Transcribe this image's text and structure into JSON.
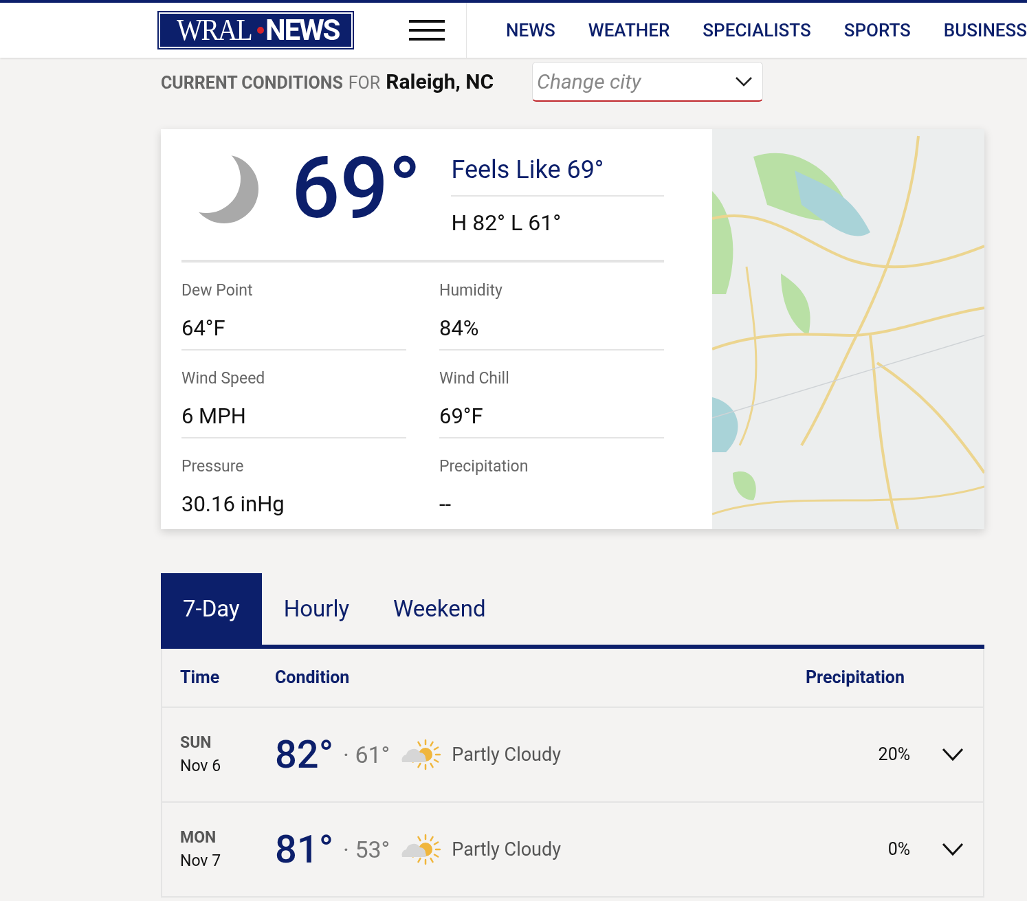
{
  "header": {
    "logo": {
      "left": "WRAL",
      "right": "NEWS"
    },
    "nav": [
      {
        "label": "NEWS"
      },
      {
        "label": "WEATHER"
      },
      {
        "label": "SPECIALISTS"
      },
      {
        "label": "SPORTS"
      },
      {
        "label": "BUSINESS"
      }
    ]
  },
  "conditions_bar": {
    "title_bold": "CURRENT CONDITIONS",
    "title_for": "FOR",
    "city": "Raleigh, NC",
    "city_select": {
      "placeholder": "Change city"
    }
  },
  "current": {
    "temperature": "69°",
    "feels_like": "Feels Like 69°",
    "high_low": "H 82° L 61°",
    "stats": [
      {
        "label": "Dew Point",
        "value": "64°F"
      },
      {
        "label": "Humidity",
        "value": "84%"
      },
      {
        "label": "Wind Speed",
        "value": "6 MPH"
      },
      {
        "label": "Wind Chill",
        "value": "69°F"
      },
      {
        "label": "Pressure",
        "value": "30.16 inHg"
      },
      {
        "label": "Precipitation",
        "value": "--"
      }
    ]
  },
  "tabs": [
    {
      "label": "7-Day",
      "selected": true
    },
    {
      "label": "Hourly",
      "selected": false
    },
    {
      "label": "Weekend",
      "selected": false
    }
  ],
  "forecast": {
    "columns": [
      "Time",
      "Condition",
      "Precipitation"
    ],
    "rows": [
      {
        "day": "SUN",
        "date": "Nov 6",
        "high": "82°",
        "low": "· 61°",
        "condition": "Partly Cloudy",
        "precip": "20%",
        "expanded": false
      },
      {
        "day": "MON",
        "date": "Nov 7",
        "high": "81°",
        "low": "· 53°",
        "condition": "Partly Cloudy",
        "precip": "0%",
        "expanded": false
      }
    ]
  }
}
